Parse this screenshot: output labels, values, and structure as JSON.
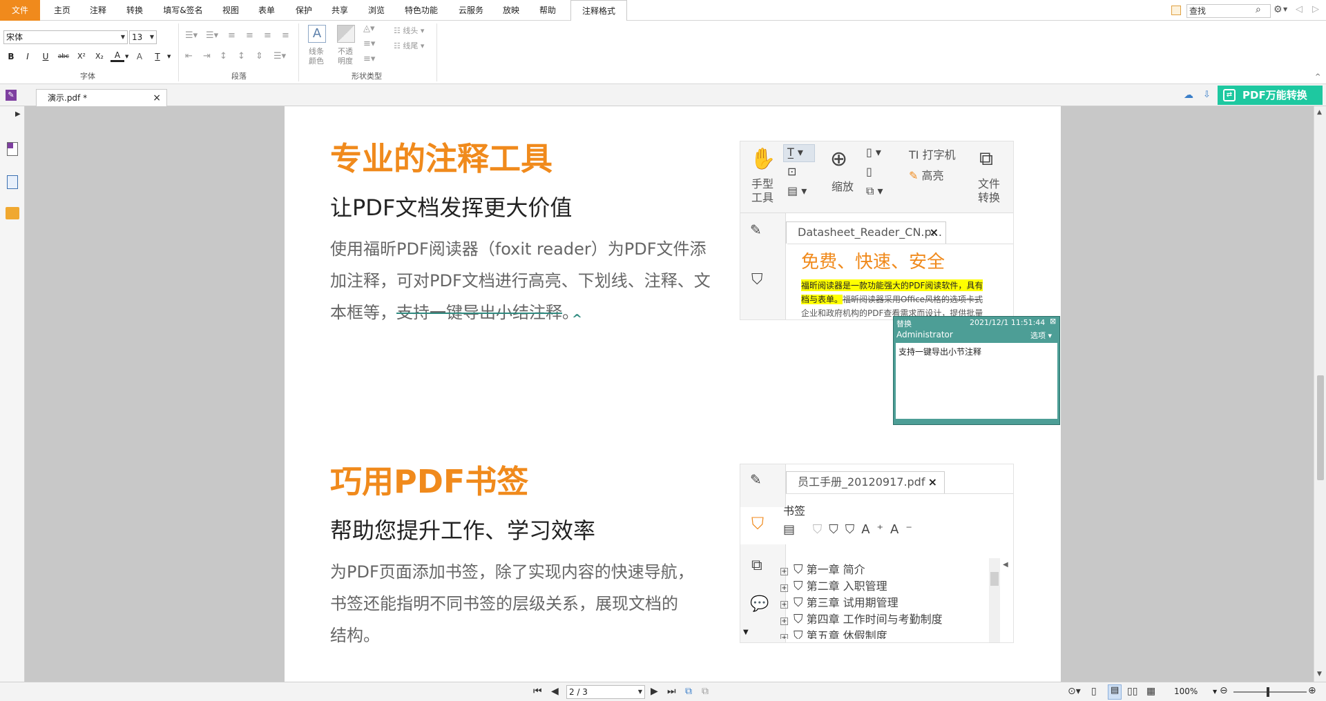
{
  "menubar": {
    "items": [
      "文件",
      "主页",
      "注释",
      "转换",
      "填写&签名",
      "视图",
      "表单",
      "保护",
      "共享",
      "浏览",
      "特色功能",
      "云服务",
      "放映",
      "帮助",
      "注释格式"
    ],
    "active": "注释格式",
    "search_placeholder": "查找"
  },
  "ribbon": {
    "font_name": "宋体",
    "font_size": "13",
    "font_buttons": [
      "B",
      "I",
      "U",
      "abc",
      "X²",
      "X₂",
      "A",
      "A",
      "T"
    ],
    "groups": [
      "字体",
      "段落",
      "形状类型"
    ],
    "line_color_label": "线条\n颜色",
    "opacity_label": "不透\n明度",
    "line_start_label": "线头",
    "line_end_label": "线尾"
  },
  "tabbar": {
    "doc_tab": "演示.pdf *",
    "convert_button": "PDF万能转换"
  },
  "page": {
    "section1": {
      "title": "专业的注释工具",
      "subtitle": "让PDF文档发挥更大价值",
      "para_lines": [
        "使用福昕PDF阅读器（foxit reader）为PDF文件添",
        "加注释，可对PDF文档进行高亮、下划线、注释、文"
      ],
      "para_line3_plain": "本框等，",
      "para_line3_strike": "支持一键导出小结注释",
      "para_line3_end": "。"
    },
    "section2": {
      "title": "巧用PDF书签",
      "subtitle": "帮助您提升工作、学习效率",
      "para_lines": [
        "为PDF页面添加书签，除了实现内容的快速导航，",
        "书签还能指明不同书签的层级关系，展现文档的",
        "结构。"
      ]
    }
  },
  "shot1": {
    "hand_tool": "手型\n工具",
    "zoom": "缩放",
    "typewriter": "打字机",
    "highlight": "高亮",
    "file_convert": "文件\n转换",
    "tab_name": "Datasheet_Reader_CN.p...",
    "doc_title": "免费、快速、安全",
    "line1": "福昕阅读器是一款功能强大的PDF阅读软件，具有",
    "line2a": "档与表单。",
    "line2b": "福昕阅读器采用Office风格的选项卡式",
    "line3": "企业和政府机构的PDF查看需求而设计，提供批量"
  },
  "note": {
    "type": "替换",
    "datetime": "2021/12/1 11:51:44",
    "author": "Administrator",
    "options": "选项",
    "content": "支持一键导出小节注释"
  },
  "shot2": {
    "tab_name": "员工手册_20120917.pdf",
    "panel_title": "书签",
    "items": [
      "第一章  简介",
      "第二章  入职管理",
      "第三章  试用期管理",
      "第四章  工作时间与考勤制度",
      "第五章  休假制度"
    ]
  },
  "statusbar": {
    "page_indicator": "2 / 3",
    "zoom": "100%"
  },
  "colors": {
    "accent": "#f08a1c",
    "convert_green": "#1ec8a0",
    "note_teal": "#4d9e96",
    "highlight_yellow": "#ffff00"
  }
}
